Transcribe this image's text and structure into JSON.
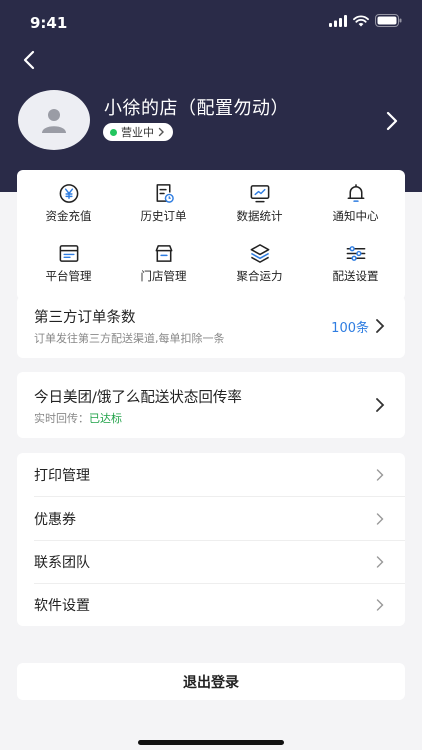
{
  "status_bar": {
    "time": "9:41"
  },
  "store": {
    "name": "小徐的店（配置勿动）",
    "status_label": "营业中"
  },
  "grid": [
    {
      "label": "资金充值",
      "icon": "yen-coin-icon"
    },
    {
      "label": "历史订单",
      "icon": "order-history-icon"
    },
    {
      "label": "数据统计",
      "icon": "chart-monitor-icon"
    },
    {
      "label": "通知中心",
      "icon": "bell-icon"
    },
    {
      "label": "平台管理",
      "icon": "browser-window-icon"
    },
    {
      "label": "门店管理",
      "icon": "store-icon"
    },
    {
      "label": "聚合运力",
      "icon": "layers-icon"
    },
    {
      "label": "配送设置",
      "icon": "sliders-icon"
    }
  ],
  "third_party": {
    "title": "第三方订单条数",
    "subtitle": "订单发往第三方配送渠道,每单扣除一条",
    "count": "100条"
  },
  "sync_rate": {
    "title": "今日美团/饿了么配送状态回传率",
    "prefix": "实时回传：",
    "status": "已达标"
  },
  "menu": [
    "打印管理",
    "优惠券",
    "联系团队",
    "软件设置"
  ],
  "logout_label": "退出登录",
  "colors": {
    "header_bg": "#2a2b48",
    "accent_blue": "#2f7de1",
    "success_green": "#22a34a"
  }
}
